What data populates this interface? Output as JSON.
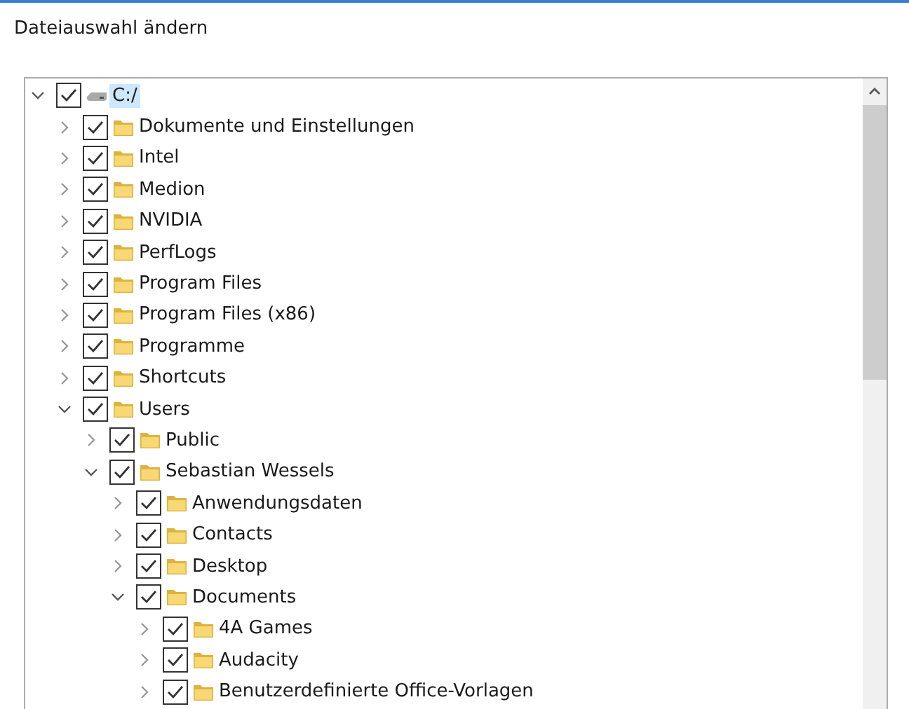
{
  "title": "Dateiauswahl ändern",
  "tree": [
    {
      "label": "C:/",
      "kind": "drive",
      "checked": true,
      "expanded": true,
      "selected": true,
      "children": [
        {
          "label": "Dokumente und Einstellungen",
          "kind": "folder",
          "checked": true,
          "expanded": false,
          "selected": false
        },
        {
          "label": "Intel",
          "kind": "folder",
          "checked": true,
          "expanded": false,
          "selected": false
        },
        {
          "label": "Medion",
          "kind": "folder",
          "checked": true,
          "expanded": false,
          "selected": false
        },
        {
          "label": "NVIDIA",
          "kind": "folder",
          "checked": true,
          "expanded": false,
          "selected": false
        },
        {
          "label": "PerfLogs",
          "kind": "folder",
          "checked": true,
          "expanded": false,
          "selected": false
        },
        {
          "label": "Program Files",
          "kind": "folder",
          "checked": true,
          "expanded": false,
          "selected": false
        },
        {
          "label": "Program Files (x86)",
          "kind": "folder",
          "checked": true,
          "expanded": false,
          "selected": false
        },
        {
          "label": "Programme",
          "kind": "folder",
          "checked": true,
          "expanded": false,
          "selected": false
        },
        {
          "label": "Shortcuts",
          "kind": "folder",
          "checked": true,
          "expanded": false,
          "selected": false
        },
        {
          "label": "Users",
          "kind": "folder",
          "checked": true,
          "expanded": true,
          "selected": false,
          "children": [
            {
              "label": "Public",
              "kind": "folder",
              "checked": true,
              "expanded": false,
              "selected": false
            },
            {
              "label": "Sebastian Wessels",
              "kind": "folder",
              "checked": true,
              "expanded": true,
              "selected": false,
              "children": [
                {
                  "label": "Anwendungsdaten",
                  "kind": "folder",
                  "checked": true,
                  "expanded": false,
                  "selected": false
                },
                {
                  "label": "Contacts",
                  "kind": "folder",
                  "checked": true,
                  "expanded": false,
                  "selected": false
                },
                {
                  "label": "Desktop",
                  "kind": "folder",
                  "checked": true,
                  "expanded": false,
                  "selected": false
                },
                {
                  "label": "Documents",
                  "kind": "folder",
                  "checked": true,
                  "expanded": true,
                  "selected": false,
                  "children": [
                    {
                      "label": "4A Games",
                      "kind": "folder",
                      "checked": true,
                      "expanded": false,
                      "selected": false
                    },
                    {
                      "label": "Audacity",
                      "kind": "folder",
                      "checked": true,
                      "expanded": false,
                      "selected": false
                    },
                    {
                      "label": "Benutzerdefinierte Office-Vorlagen",
                      "kind": "folder",
                      "checked": true,
                      "expanded": false,
                      "selected": false
                    }
                  ]
                }
              ]
            }
          ]
        }
      ]
    }
  ]
}
